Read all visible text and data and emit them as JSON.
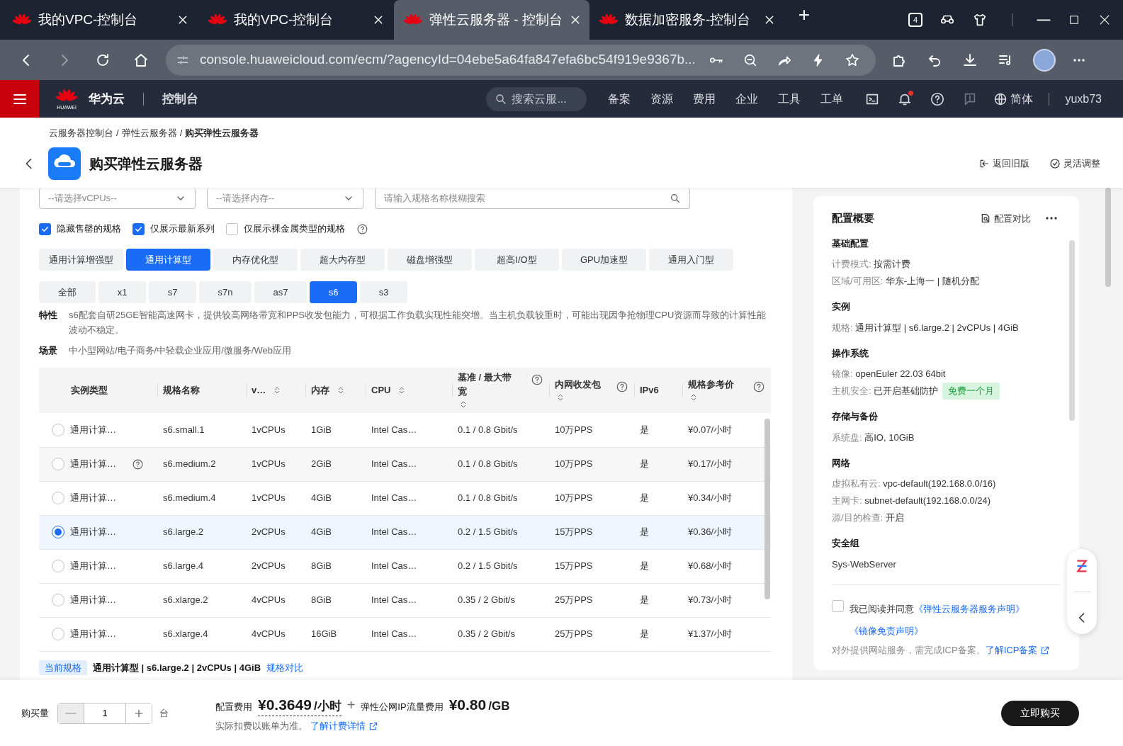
{
  "browser": {
    "tabs": [
      {
        "title": "我的VPC-控制台",
        "selected": false
      },
      {
        "title": "我的VPC-控制台",
        "selected": false
      },
      {
        "title": "弹性云服务器 - 控制台",
        "selected": true
      },
      {
        "title": "数据加密服务-控制台",
        "selected": false
      }
    ],
    "new_tab": "+",
    "tab_count": "4",
    "address": "console.huaweicloud.com/ecm/?agencyId=04ebe5a64fa847efa6bc54f919e9367b..."
  },
  "app_header": {
    "brand": "华为云",
    "logo_caption": "HUAWEI",
    "section": "控制台",
    "search_placeholder": "搜索云服...",
    "nav": [
      "备案",
      "资源",
      "费用",
      "企业",
      "工具",
      "工单"
    ],
    "language": "简体",
    "user": "yuxb73"
  },
  "breadcrumb": [
    "云服务器控制台",
    "弹性云服务器",
    "购买弹性云服务器"
  ],
  "breadcrumb_separator": "/",
  "page_title": "购买弹性云服务器",
  "header_actions": [
    "返回旧版",
    "灵活调整"
  ],
  "filters": {
    "vcpu_placeholder": "--请选择vCPUs--",
    "memory_placeholder": "--请选择内存--",
    "search_placeholder": "请输入规格名称模糊搜索",
    "checkboxes": [
      {
        "label": "隐藏售罄的规格",
        "checked": true
      },
      {
        "label": "仅展示最新系列",
        "checked": true
      },
      {
        "label": "仅展示裸金属类型的规格",
        "checked": false
      }
    ]
  },
  "type_tabs": [
    {
      "label": "通用计算增强型",
      "selected": false
    },
    {
      "label": "通用计算型",
      "selected": true
    },
    {
      "label": "内存优化型",
      "selected": false
    },
    {
      "label": "超大内存型",
      "selected": false
    },
    {
      "label": "磁盘增强型",
      "selected": false
    },
    {
      "label": "超高I/O型",
      "selected": false
    },
    {
      "label": "GPU加速型",
      "selected": false
    },
    {
      "label": "通用入门型",
      "selected": false
    }
  ],
  "series_tabs": [
    {
      "label": "全部",
      "selected": false
    },
    {
      "label": "x1",
      "selected": false
    },
    {
      "label": "s7",
      "selected": false
    },
    {
      "label": "s7n",
      "selected": false
    },
    {
      "label": "as7",
      "selected": false
    },
    {
      "label": "s6",
      "selected": true
    },
    {
      "label": "s3",
      "selected": false
    }
  ],
  "description": [
    {
      "label": "特性",
      "text": "s6配套自研25GE智能高速网卡，提供较高网络带宽和PPS收发包能力，可根据工作负载实现性能突增。当主机负载较重时，可能出现因争抢物理CPU资源而导致的计算性能波动不稳定。"
    },
    {
      "label": "场景",
      "text": "中小型网站/电子商务/中轻载企业应用/微服务/Web应用"
    }
  ],
  "table": {
    "columns": [
      {
        "label": "实例类型",
        "sortable": false,
        "help": false
      },
      {
        "label": "规格名称",
        "sortable": false,
        "help": false
      },
      {
        "label": "v…",
        "sortable": true,
        "help": false
      },
      {
        "label": "内存",
        "sortable": true,
        "help": false
      },
      {
        "label": "CPU",
        "sortable": true,
        "help": false
      },
      {
        "label": "基准 / 最大带宽",
        "sortable": true,
        "help": true
      },
      {
        "label": "内网收发包",
        "sortable": true,
        "help": true
      },
      {
        "label": "IPv6",
        "sortable": false,
        "help": false
      },
      {
        "label": "规格参考价",
        "sortable": true,
        "help": true
      }
    ],
    "rows": [
      {
        "selected": false,
        "help": false,
        "cells": [
          "通用计算…",
          "s6.small.1",
          "1vCPUs",
          "1GiB",
          "Intel Cas…",
          "0.1 / 0.8 Gbit/s",
          "10万PPS",
          "是",
          "¥0.07/小时"
        ]
      },
      {
        "selected": false,
        "help": true,
        "cells": [
          "通用计算…",
          "s6.medium.2",
          "1vCPUs",
          "2GiB",
          "Intel Cas…",
          "0.1 / 0.8 Gbit/s",
          "10万PPS",
          "是",
          "¥0.17/小时"
        ]
      },
      {
        "selected": false,
        "help": false,
        "cells": [
          "通用计算…",
          "s6.medium.4",
          "1vCPUs",
          "4GiB",
          "Intel Cas…",
          "0.1 / 0.8 Gbit/s",
          "10万PPS",
          "是",
          "¥0.34/小时"
        ]
      },
      {
        "selected": true,
        "help": false,
        "cells": [
          "通用计算…",
          "s6.large.2",
          "2vCPUs",
          "4GiB",
          "Intel Cas…",
          "0.2 / 1.5 Gbit/s",
          "15万PPS",
          "是",
          "¥0.36/小时"
        ]
      },
      {
        "selected": false,
        "help": false,
        "cells": [
          "通用计算…",
          "s6.large.4",
          "2vCPUs",
          "8GiB",
          "Intel Cas…",
          "0.2 / 1.5 Gbit/s",
          "15万PPS",
          "是",
          "¥0.68/小时"
        ]
      },
      {
        "selected": false,
        "help": false,
        "cells": [
          "通用计算…",
          "s6.xlarge.2",
          "4vCPUs",
          "8GiB",
          "Intel Cas…",
          "0.35 / 2 Gbit/s",
          "25万PPS",
          "是",
          "¥0.73/小时"
        ]
      },
      {
        "selected": false,
        "help": false,
        "cells": [
          "通用计算…",
          "s6.xlarge.4",
          "4vCPUs",
          "16GiB",
          "Intel Cas…",
          "0.35 / 2 Gbit/s",
          "25万PPS",
          "是",
          "¥1.37/小时"
        ]
      }
    ]
  },
  "current_spec": {
    "badge": "当前规格",
    "text": "通用计算型 | s6.large.2 | 2vCPUs | 4GiB",
    "link": "规格对比"
  },
  "summary": {
    "title": "配置概要",
    "compare": "配置对比",
    "sections": [
      {
        "heading": "基础配置",
        "items": [
          {
            "label": "计费模式:",
            "value": "按需计费"
          },
          {
            "label": "区域/可用区:",
            "value": "华东-上海一 | 随机分配"
          }
        ]
      },
      {
        "heading": "实例",
        "items": [
          {
            "label": "规格:",
            "value": "通用计算型 | s6.large.2 | 2vCPUs | 4GiB"
          }
        ]
      },
      {
        "heading": "操作系统",
        "items": [
          {
            "label": "镜像:",
            "value": "openEuler 22.03 64bit"
          },
          {
            "label": "主机安全:",
            "value": "已开启基础防护",
            "tag": "免费一个月"
          }
        ]
      },
      {
        "heading": "存储与备份",
        "items": [
          {
            "label": "系统盘:",
            "value": "高IO, 10GiB"
          }
        ]
      },
      {
        "heading": "网络",
        "items": [
          {
            "label": "虚拟私有云:",
            "value": "vpc-default(192.168.0.0/16)"
          },
          {
            "label": "主网卡:",
            "value": "subnet-default(192.168.0.0/24)"
          },
          {
            "label": "源/目的检查:",
            "value": "开启"
          }
        ]
      },
      {
        "heading": "安全组",
        "items": [
          {
            "value": "Sys-WebServer"
          }
        ]
      }
    ],
    "agreement": {
      "checked": false,
      "text": "我已阅读并同意",
      "links": [
        "《弹性云服务器服务声明》",
        "《镜像免责声明》"
      ]
    },
    "icp_note": "对外提供网站服务，需完成ICP备案。",
    "icp_link": "了解ICP备案"
  },
  "footer": {
    "quantity_label": "购买量",
    "quantity": "1",
    "quantity_unit": "台",
    "config_fee_label": "配置费用",
    "config_fee": "¥0.3649",
    "config_fee_unit": "/小时",
    "plus": "+",
    "traffic_fee_label": "弹性公网IP流量费用",
    "traffic_fee": "¥0.80",
    "traffic_fee_unit": "/GB",
    "note": "实际扣费以账单为准。",
    "note_link": "了解计费详情",
    "buy": "立即购买"
  }
}
